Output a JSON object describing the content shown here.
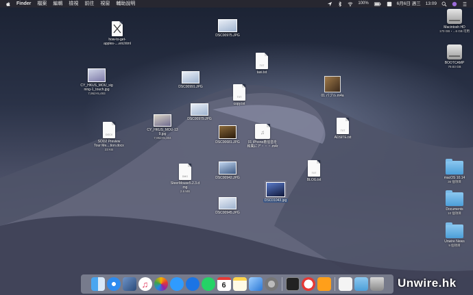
{
  "menubar": {
    "app_name": "Finder",
    "menus": [
      "檔案",
      "編輯",
      "檢視",
      "前往",
      "視窗",
      "輔助說明"
    ],
    "battery": "100%",
    "date": "6月6日 週三",
    "time": "13:09"
  },
  "desktop_icons": {
    "how_to": {
      "label": "how-to-get-",
      "label2": "apples-....ent.html"
    },
    "dsc975": {
      "label": "DSC00975.JPG"
    },
    "taxi": {
      "label": "taxi.txt"
    },
    "cy_sig": {
      "label": "CY_HKUS_MOU_sig",
      "label2": "ning-1_touch.jpg",
      "sub": "7,952×5,493"
    },
    "dsc991": {
      "label": "DSC00991.JPG"
    },
    "copy": {
      "label": "copy.txt"
    },
    "pable": {
      "label": "01 パブル.m4a"
    },
    "dsc979": {
      "label": "DSC00979.JPG"
    },
    "cy13": {
      "label": "CY_HKUS_MOU-13",
      "label2": "9.jpg",
      "sub": "7,952×5,304"
    },
    "sod2": {
      "label": "SOD2 Preview",
      "label2": "Tour Me....tion.docx",
      "sub": "23 KB"
    },
    "dsc681": {
      "label": "DSC00681.JPG"
    },
    "iphone": {
      "label": "01 iPhone着信音を",
      "label2": "和風にア・・・.m4r"
    },
    "adsite": {
      "label": "ADSITE.txt"
    },
    "steer": {
      "label": "SteerMouse5.2.3.d",
      "label2": "mg",
      "sub": "2.6 MB"
    },
    "dsc942": {
      "label": "DSC00942.JPG"
    },
    "blog": {
      "label": "BLOG.txt"
    },
    "dsc1043": {
      "label": "DSC01043.jpg"
    },
    "dsc945": {
      "label": "DSC00945.JPG"
    },
    "mac_hd": {
      "label": "Macintosh HD",
      "sub": "170 GB・...6 GB 可用"
    },
    "bootcamp": {
      "label": "BOOTCAMP",
      "sub": "79.83 GB"
    },
    "macos": {
      "label": "macOS 10.14",
      "sub": "36 個項目"
    },
    "documents": {
      "label": "Documents",
      "sub": "10 個項目"
    },
    "unwire": {
      "label": "Unwire News",
      "sub": "9 個項目"
    }
  },
  "dock_apps": [
    "finder-icon",
    "safari-icon",
    "preview-icon",
    "music-icon",
    "photos-icon",
    "messages-icon",
    "messenger-icon",
    "whatsapp-icon",
    "calendar-icon",
    "notes-icon",
    "xcode-icon",
    "settings-icon",
    "terminal-icon",
    "news-icon",
    "home-icon",
    "document-icon",
    "folder-icon",
    "trash-icon"
  ],
  "calendar_day": "6",
  "watermark": "Unwire.hk"
}
